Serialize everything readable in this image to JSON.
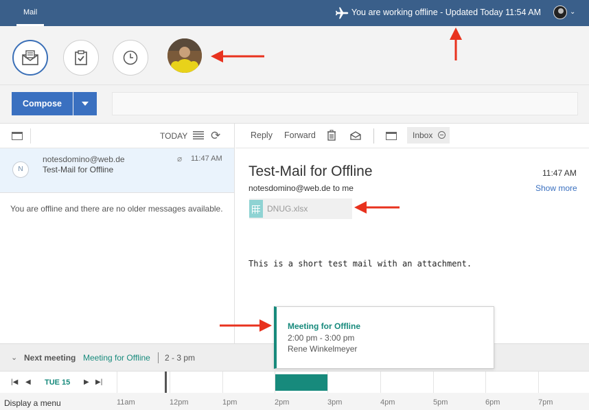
{
  "topbar": {
    "tab_label": "Mail",
    "status_text": "You are working offline - Updated Today 11:54 AM"
  },
  "toolbar": {
    "compose_label": "Compose"
  },
  "left_pane": {
    "today_label": "TODAY",
    "message": {
      "avatar_initial": "N",
      "from": "notesdomino@web.de",
      "subject": "Test-Mail for Offline",
      "time": "11:47 AM"
    },
    "offline_note": "You are offline and there are no older messages available."
  },
  "reading_toolbar": {
    "reply_label": "Reply",
    "forward_label": "Forward",
    "folder_badge": "Inbox"
  },
  "mail": {
    "title": "Test-Mail for Offline",
    "time": "11:47 AM",
    "from_line": "notesdomino@web.de to me",
    "show_more": "Show more",
    "attachment_name": "DNUG.xlsx",
    "body": "This is a short test mail with an attachment."
  },
  "meeting_bar": {
    "label": "Next meeting",
    "title": "Meeting for Offline",
    "time": "2 - 3 pm"
  },
  "timeline": {
    "day": "TUE 15",
    "hours": [
      "11am",
      "12pm",
      "1pm",
      "2pm",
      "3pm",
      "4pm",
      "5pm",
      "6pm",
      "7pm"
    ],
    "menu_label": "Display a menu"
  },
  "popup": {
    "title": "Meeting for Offline",
    "time": "2:00 pm - 3:00 pm",
    "organizer": "Rene Winkelmeyer"
  },
  "colors": {
    "topbar": "#3a5f8a",
    "accent": "#3a70c0",
    "meeting": "#178a7c",
    "arrow": "#e8321e"
  },
  "icons": {
    "offline": "airplane-icon",
    "mail": "mail-icon",
    "tasks": "tasks-icon",
    "clock": "clock-icon",
    "refresh": "refresh-icon",
    "trash": "trash-icon",
    "attachment": "paperclip-icon"
  }
}
